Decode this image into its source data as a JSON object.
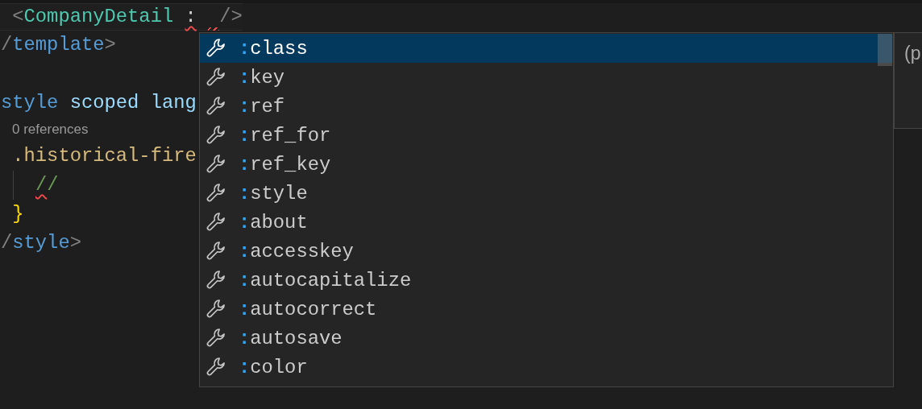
{
  "editor": {
    "lines": [
      {
        "kind": "current",
        "tokens": [
          {
            "text": " <",
            "kind": "punct",
            "error": false
          },
          {
            "text": "CompanyDetail",
            "kind": "component",
            "error": false
          },
          {
            "text": ":",
            "kind": "text",
            "error": true,
            "space_before": true
          },
          {
            "kind": "gap",
            "error": true,
            "space_before": true
          },
          {
            "text": "/>",
            "kind": "punct",
            "error": false
          }
        ]
      },
      {
        "kind": "code",
        "tokens": [
          {
            "text": "/",
            "kind": "punct",
            "error": false
          },
          {
            "text": "template",
            "kind": "tag",
            "error": false
          },
          {
            "text": ">",
            "kind": "punct",
            "error": false
          }
        ]
      },
      {
        "kind": "blank"
      },
      {
        "kind": "code",
        "tokens": [
          {
            "text": "style",
            "kind": "tag",
            "error": false
          },
          {
            "text": "scoped lang",
            "kind": "attr",
            "error": false,
            "space_before": true
          }
        ]
      },
      {
        "kind": "codelens",
        "text": "0 references"
      },
      {
        "kind": "code",
        "tokens": [
          {
            "text": " .historical-fire",
            "kind": "selector",
            "error": false
          }
        ]
      },
      {
        "kind": "guide",
        "tokens": [
          {
            "text": "/",
            "kind": "comment",
            "error": true
          },
          {
            "text": "/",
            "kind": "comment",
            "error": false
          }
        ]
      },
      {
        "kind": "code",
        "tokens": [
          {
            "text": " }",
            "kind": "brace",
            "error": false
          }
        ]
      },
      {
        "kind": "code",
        "tokens": [
          {
            "text": "/",
            "kind": "punct",
            "error": false
          },
          {
            "text": "style",
            "kind": "tag",
            "error": false
          },
          {
            "text": ">",
            "kind": "punct",
            "error": false
          }
        ]
      }
    ]
  },
  "suggestions": {
    "items": [
      {
        "match": ":",
        "label": "class",
        "selected": true
      },
      {
        "match": ":",
        "label": "key",
        "selected": false
      },
      {
        "match": ":",
        "label": "ref",
        "selected": false
      },
      {
        "match": ":",
        "label": "ref_for",
        "selected": false
      },
      {
        "match": ":",
        "label": "ref_key",
        "selected": false
      },
      {
        "match": ":",
        "label": "style",
        "selected": false
      },
      {
        "match": ":",
        "label": "about",
        "selected": false
      },
      {
        "match": ":",
        "label": "accesskey",
        "selected": false
      },
      {
        "match": ":",
        "label": "autocapitalize",
        "selected": false
      },
      {
        "match": ":",
        "label": "autocorrect",
        "selected": false
      },
      {
        "match": ":",
        "label": "autosave",
        "selected": false
      },
      {
        "match": ":",
        "label": "color",
        "selected": false
      }
    ],
    "details": "(p"
  }
}
